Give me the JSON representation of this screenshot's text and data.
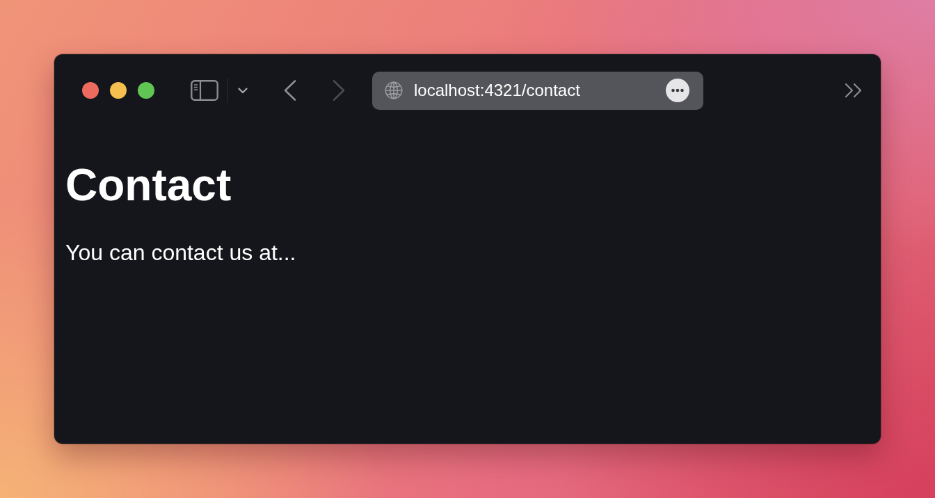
{
  "window": {
    "controls": [
      {
        "color": "#ed6a5e"
      },
      {
        "color": "#f4bf4f"
      },
      {
        "color": "#61c554"
      }
    ]
  },
  "toolbar": {
    "navigation": [
      {
        "kind": "back",
        "disabled": false
      },
      {
        "kind": "forward",
        "disabled": true
      }
    ],
    "address_bar": {
      "url": "localhost:4321/contact"
    }
  },
  "page": {
    "heading": "Contact",
    "text": "You can contact us at..."
  }
}
